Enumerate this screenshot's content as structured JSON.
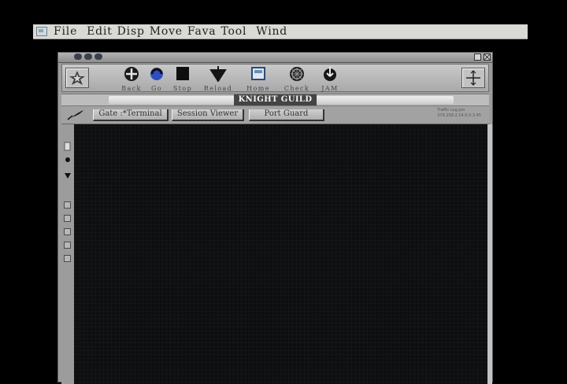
{
  "menubar": {
    "items": [
      "File",
      "Edit",
      "Disp",
      "Move",
      "Fava",
      "Tool",
      "Wind"
    ]
  },
  "toolbar": {
    "buttons": [
      {
        "label": "Back",
        "icon": "back-icon"
      },
      {
        "label": "Go",
        "icon": "go-icon"
      },
      {
        "label": "Stop",
        "icon": "stop-icon"
      },
      {
        "label": "Reload",
        "icon": "reload-icon"
      },
      {
        "label": "Home",
        "icon": "home-icon"
      },
      {
        "label": "Check",
        "icon": "check-icon"
      },
      {
        "label": "JAM",
        "icon": "jam-icon"
      }
    ]
  },
  "page": {
    "title": "KNIGHT GUILD"
  },
  "tabs": [
    {
      "label": "Gate :*Terminal"
    },
    {
      "label": "Session Viewer"
    },
    {
      "label": "Port Guard"
    }
  ],
  "stats": {
    "line1": "Traffic Log.pm",
    "line2": "379.258.2.14:0.0.3.45"
  },
  "colors": {
    "window_frame": "#9c9c9c",
    "content_bg": "#0e0f10",
    "title_bg": "#444444",
    "menubar_bg": "#d9d9d6"
  }
}
